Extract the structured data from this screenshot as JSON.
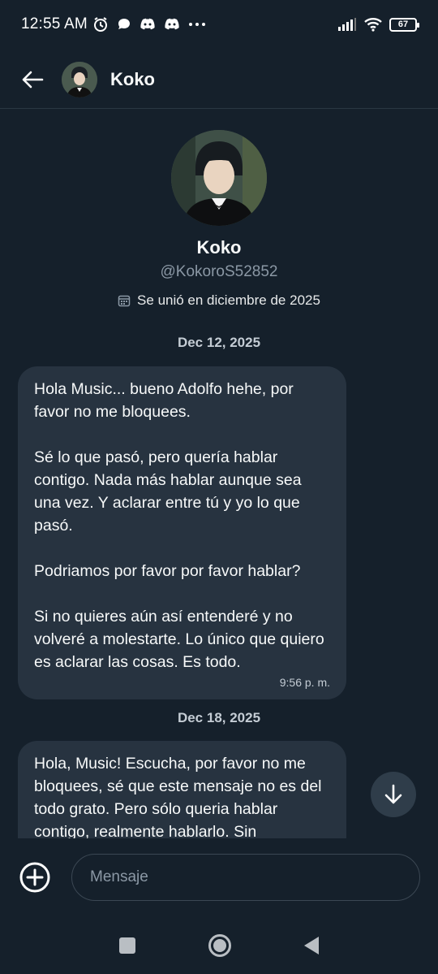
{
  "status_bar": {
    "time": "12:55 AM",
    "left_icons": [
      "alarm-icon",
      "chat-bubble-icon",
      "discord-icon",
      "discord-icon",
      "more-dots-icon"
    ],
    "right_icons": [
      "signal-icon",
      "wifi-icon"
    ],
    "battery": "67"
  },
  "header": {
    "back_icon": "arrow-left-icon",
    "title": "Koko"
  },
  "profile": {
    "name": "Koko",
    "handle": "@KokoroS52852",
    "joined": "Se unió en diciembre de 2025"
  },
  "conversation": [
    {
      "date": "Dec 12, 2025",
      "paragraphs": [
        "Hola Music... bueno Adolfo hehe, por favor no me bloquees.",
        "Sé lo que pasó, pero quería hablar contigo. Nada más hablar aunque sea una vez. Y aclarar entre tú y yo lo que pasó.",
        "Podriamos por favor por favor hablar?",
        "Si no quieres aún así entenderé y no volveré a molestarte. Lo único que quiero es aclarar las cosas. Es todo."
      ],
      "time": "9:56 p. m."
    },
    {
      "date": "Dec 18, 2025",
      "paragraphs": [
        "Hola, Music! Escucha, por favor no me bloquees, sé que este mensaje no es del todo grato. Pero sólo queria hablar contigo,  realmente hablarlo. Sin"
      ]
    }
  ],
  "composer": {
    "placeholder": "Mensaje"
  },
  "colors": {
    "background": "#15202b",
    "bubble": "#273340",
    "secondary_text": "#8b98a5"
  }
}
